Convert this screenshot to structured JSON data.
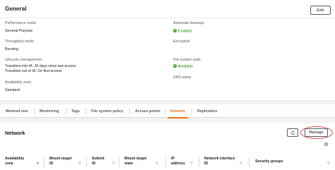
{
  "general": {
    "title": "General",
    "edit_label": "Edit",
    "performance_mode": {
      "label": "Performance mode",
      "value": "General Purpose"
    },
    "throughput_mode": {
      "label": "Throughput mode",
      "value": "Bursting"
    },
    "lifecycle_management": {
      "label": "Lifecycle management",
      "line1": "Transition into IA: 30 days since last access",
      "line2": "Transition out of IA: On first access"
    },
    "availability_zone": {
      "label": "Availability zone",
      "value": "Standard"
    },
    "automatic_backups": {
      "label": "Automatic backups",
      "value": "Enabled"
    },
    "encrypted": {
      "label": "Encrypted"
    },
    "file_system_state": {
      "label": "File system state",
      "value": "Available"
    },
    "dns_name": {
      "label": "DNS name"
    }
  },
  "tabs": [
    {
      "label": "Metered size"
    },
    {
      "label": "Monitoring"
    },
    {
      "label": "Tags"
    },
    {
      "label": "File system policy"
    },
    {
      "label": "Access points"
    },
    {
      "label": "Network",
      "active": true
    },
    {
      "label": "Replication"
    }
  ],
  "network": {
    "title": "Network",
    "manage_label": "Manage",
    "columns": [
      {
        "line1": "Availability",
        "line2": "zone"
      },
      {
        "line1": "Mount target",
        "line2": "ID"
      },
      {
        "line1": "Subnet",
        "line2": "ID"
      },
      {
        "line1": "Mount target",
        "line2": "state"
      },
      {
        "line1": "IP",
        "line2": "address"
      },
      {
        "line1": "Network interface",
        "line2": "ID"
      },
      {
        "line1": "Security groups",
        "line2": ""
      }
    ]
  },
  "colors": {
    "active_tab": "#ec7211",
    "success": "#1d8102",
    "highlight_circle": "#d9534f"
  }
}
